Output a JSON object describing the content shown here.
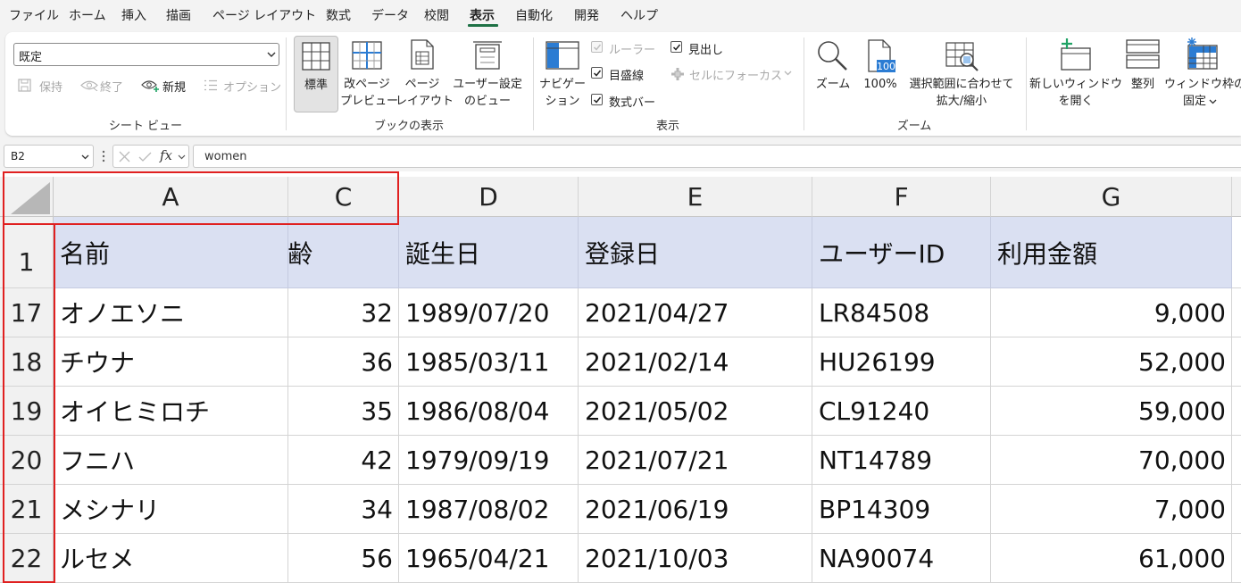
{
  "menu": {
    "tabs": [
      "ファイル",
      "ホーム",
      "挿入",
      "描画",
      "ページ レイアウト",
      "数式",
      "データ",
      "校閲",
      "表示",
      "自動化",
      "開発",
      "ヘルプ"
    ],
    "active_tab": "表示"
  },
  "ribbon": {
    "sheet_view": {
      "dropdown_value": "既定",
      "keep_label": "保持",
      "exit_label": "終了",
      "new_label": "新規",
      "options_label": "オプション",
      "group_label": "シート ビュー"
    },
    "workbook_views": {
      "normal_label": "標準",
      "page_break_line1": "改ページ",
      "page_break_line2": "プレビュー",
      "page_layout_line1": "ページ",
      "page_layout_line2": "レイアウト",
      "custom_line1": "ユーザー設定",
      "custom_line2": "のビュー",
      "group_label": "ブックの表示"
    },
    "show": {
      "navigation_line1": "ナビゲー",
      "navigation_line2": "ション",
      "ruler_label": "ルーラー",
      "headings_label": "見出し",
      "gridlines_label": "目盛線",
      "focus_cell_label": "セルにフォーカス",
      "formula_bar_label": "数式バー",
      "group_label": "表示"
    },
    "zoom": {
      "zoom_label": "ズーム",
      "hundred_label": "100%",
      "hundred_icon_text": "100",
      "selection_line1": "選択範囲に合わせて",
      "selection_line2": "拡大/縮小",
      "group_label": "ズーム"
    },
    "window": {
      "new_window_line1": "新しいウィンドウ",
      "new_window_line2": "を開く",
      "arrange_label": "整列",
      "freeze_line1": "ウィンドウ枠の",
      "freeze_line2": "固定"
    }
  },
  "formula_bar": {
    "name_box": "B2",
    "fx_label": "fx",
    "content": "women"
  },
  "sheet": {
    "column_headers": [
      "A",
      "C",
      "D",
      "E",
      "F",
      "G"
    ],
    "header_row": {
      "row_number": "1",
      "cells": [
        "名前",
        "齢",
        "誕生日",
        "登録日",
        "ユーザーID",
        "利用金額"
      ]
    },
    "rows": [
      {
        "row_number": "17",
        "cells": [
          "オノエソニ",
          "32",
          "1989/07/20",
          "2021/04/27",
          "LR84508",
          "9,000"
        ]
      },
      {
        "row_number": "18",
        "cells": [
          "チウナ",
          "36",
          "1985/03/11",
          "2021/02/14",
          "HU26199",
          "52,000"
        ]
      },
      {
        "row_number": "19",
        "cells": [
          "オイヒミロチ",
          "35",
          "1986/08/04",
          "2021/05/02",
          "CL91240",
          "59,000"
        ]
      },
      {
        "row_number": "20",
        "cells": [
          "フニハ",
          "42",
          "1979/09/19",
          "2021/07/21",
          "NT14789",
          "70,000"
        ]
      },
      {
        "row_number": "21",
        "cells": [
          "メシナリ",
          "34",
          "1987/08/02",
          "2021/06/19",
          "BP14309",
          "7,000"
        ]
      },
      {
        "row_number": "22",
        "cells": [
          "ルセメ",
          "56",
          "1965/04/21",
          "2021/10/03",
          "NA90074",
          "61,000"
        ]
      }
    ]
  },
  "colors": {
    "header_row_fill": "#dae0f2",
    "highlight_border": "#e02020",
    "active_tab_underline": "#1e7145",
    "icon_blue": "#2b7cd3",
    "icon_green": "#21a366"
  }
}
